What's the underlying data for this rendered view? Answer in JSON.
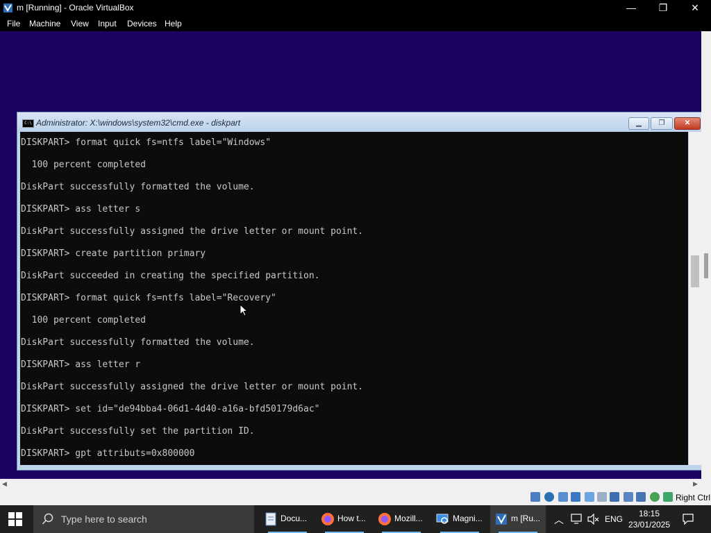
{
  "host_window": {
    "title": "m [Running] - Oracle VirtualBox",
    "controls": {
      "minimize": "—",
      "maximize": "❐",
      "close": "✕"
    }
  },
  "menubar": {
    "items": [
      "File",
      "Machine",
      "View",
      "Input",
      "Devices",
      "Help"
    ]
  },
  "guest": {
    "background_color": "#1c0361",
    "cmd_window": {
      "title": "Administrator: X:\\windows\\system32\\cmd.exe - diskpart",
      "icon_text": "C:\\",
      "lines": [
        "DISKPART> format quick fs=ntfs label=\"Windows\"",
        "",
        "  100 percent completed",
        "",
        "DiskPart successfully formatted the volume.",
        "",
        "DISKPART> ass letter s",
        "",
        "DiskPart successfully assigned the drive letter or mount point.",
        "",
        "DISKPART> create partition primary",
        "",
        "DiskPart succeeded in creating the specified partition.",
        "",
        "DISKPART> format quick fs=ntfs label=\"Recovery\"",
        "",
        "  100 percent completed",
        "",
        "DiskPart successfully formatted the volume.",
        "",
        "DISKPART> ass letter r",
        "",
        "DiskPart successfully assigned the drive letter or mount point.",
        "",
        "DISKPART> set id=\"de94bba4-06d1-4d40-a16a-bfd50179d6ac\"",
        "",
        "DiskPart successfully set the partition ID.",
        "",
        "DISKPART> gpt attributs=0x800000"
      ]
    }
  },
  "statusbar": {
    "host_key": "Right Ctrl",
    "icons": [
      "hard-disk-icon",
      "optical-drive-icon",
      "audio-icon",
      "network-icon",
      "usb-icon",
      "shared-folders-icon",
      "display-icon",
      "recording-icon",
      "mouse-integration-icon",
      "cpu-icon",
      "arrow-icon",
      "keyboard-icon"
    ]
  },
  "taskbar": {
    "search_placeholder": "Type here to search",
    "items": [
      {
        "label": "Docu...",
        "icon": "document-icon",
        "active": false
      },
      {
        "label": "How t...",
        "icon": "firefox-icon",
        "active": false
      },
      {
        "label": "Mozill...",
        "icon": "firefox-icon",
        "active": false
      },
      {
        "label": "Magni...",
        "icon": "magnifier-icon",
        "active": false
      },
      {
        "label": "m [Ru...",
        "icon": "virtualbox-icon",
        "active": true
      }
    ],
    "tray": {
      "language": "ENG",
      "time": "18:15",
      "date": "23/01/2025"
    }
  }
}
